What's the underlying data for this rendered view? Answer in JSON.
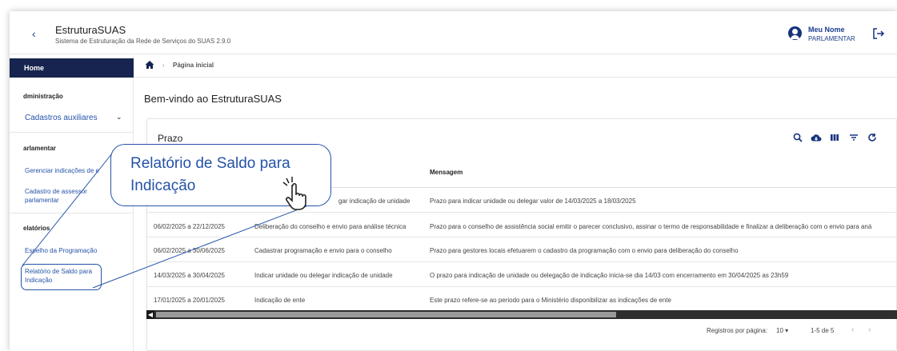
{
  "header": {
    "title": "EstruturaSUAS",
    "subtitle": "Sistema de Estruturação da Rede de Serviços do SUAS 2.9.0",
    "back_icon": "chevron-left-icon",
    "user_name": "Meu Nome",
    "user_role": "PARLAMENTAR",
    "user_icon": "account-circle-icon",
    "logout_icon": "logout-icon"
  },
  "sidebar": {
    "home": "Home",
    "sections": [
      {
        "label": "dministração",
        "items": [
          "Cadastros auxiliares"
        ]
      },
      {
        "label": "arlamentar",
        "items": [
          "Gerenciar indicações de e",
          "Cadastro de assessor\nparlamentar"
        ]
      },
      {
        "label": "elatórios",
        "items": [
          "Espelho da Programação",
          "Relatório de Saldo para\nIndicação"
        ]
      }
    ]
  },
  "breadcrumb": {
    "home_icon": "home-icon",
    "current": "Página inicial"
  },
  "main": {
    "title": "Bem-vindo ao EstruturaSUAS",
    "card_title": "Prazo",
    "toolbar_icons": [
      "search-icon",
      "cloud-download-icon",
      "columns-icon",
      "filter-icon",
      "refresh-icon"
    ],
    "columns": [
      "Mensagem"
    ],
    "rows": [
      {
        "period": "",
        "action": "gar indicação de unidade",
        "message": "Prazo para indicar unidade ou delegar valor de 14/03/2025 a 18/03/2025"
      },
      {
        "period": "06/02/2025 a 22/12/2025",
        "action": "Deliberação do conselho e envio para análise técnica",
        "message": "Prazo para o conselho de assistência social emitir o parecer conclusivo, assinar o termo de responsabilidade e finalizar a deliberação com o envio para aná"
      },
      {
        "period": "06/02/2025 a 30/06/2025",
        "action": "Cadastrar programação e envio para o conselho",
        "message": "Prazo para gestores locais efetuarem o cadastro da programação com o envio para deliberação do conselho"
      },
      {
        "period": "14/03/2025 a 30/04/2025",
        "action": "Indicar unidade ou delegar indicação de unidade",
        "message": "O prazo para indicação de unidade ou delegação de indicação inicia-se dia 14/03 com encerramento em 30/04/2025 as 23h59"
      },
      {
        "period": "17/01/2025 a 20/01/2025",
        "action": "Indicação de ente",
        "message": "Este prazo refere-se ao periodo para o Ministério disponibilizar as indicações de ente"
      }
    ],
    "footer": {
      "rows_per_page_label": "Registros por página:",
      "rows_per_page_value": "10",
      "range": "1-5 de 5"
    }
  },
  "callout": {
    "text_line1": "Relatório de Saldo para",
    "text_line2": "Indicação",
    "icon": "pointing-hand-icon"
  },
  "colors": {
    "primary": "#16244f",
    "link": "#2553a8",
    "accent": "#16337e"
  }
}
